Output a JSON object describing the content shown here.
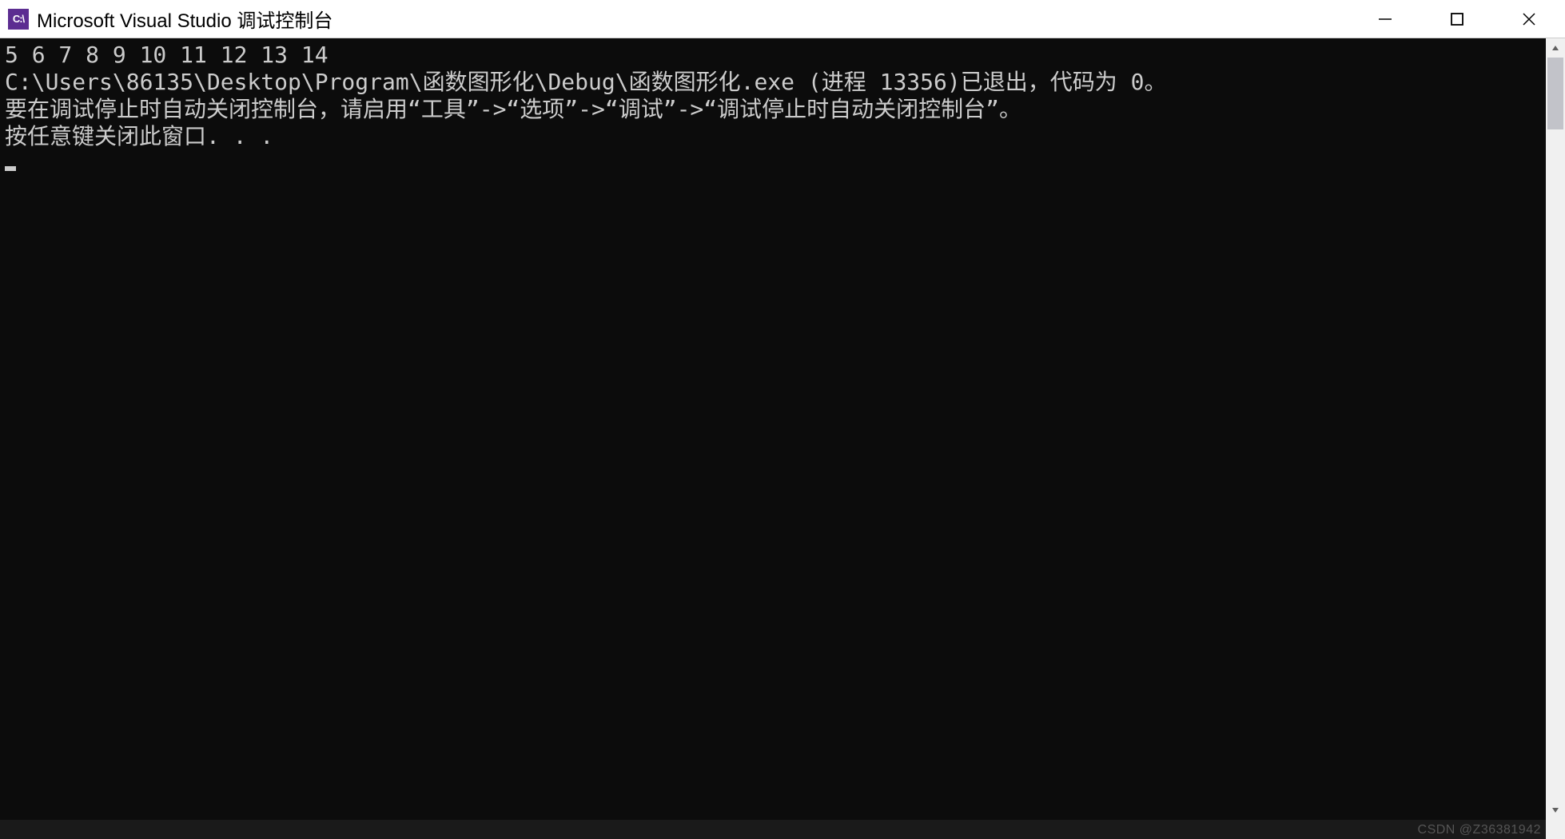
{
  "window": {
    "icon_text": "C:\\",
    "title": "Microsoft Visual Studio 调试控制台"
  },
  "console": {
    "line1": "5 6 7 8 9 10 11 12 13 14",
    "line2": "C:\\Users\\86135\\Desktop\\Program\\函数图形化\\Debug\\函数图形化.exe (进程 13356)已退出，代码为 0。",
    "line3": "要在调试停止时自动关闭控制台，请启用“工具”->“选项”->“调试”->“调试停止时自动关闭控制台”。",
    "line4": "按任意键关闭此窗口. . ."
  },
  "watermark": "CSDN @Z36381942"
}
